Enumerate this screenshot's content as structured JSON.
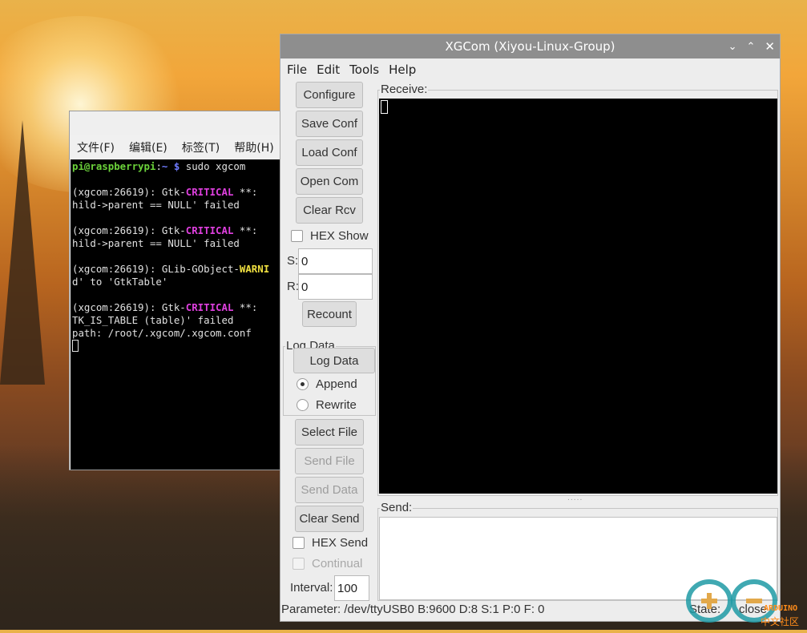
{
  "terminal": {
    "menu": [
      "文件(F)",
      "编辑(E)",
      "标签(T)",
      "帮助(H)"
    ],
    "lines": [
      {
        "parts": [
          {
            "t": "pi@raspberrypi",
            "c": "t-green"
          },
          {
            "t": ":",
            "c": ""
          },
          {
            "t": "~ $",
            "c": "t-blue"
          },
          {
            "t": " sudo xgcom",
            "c": ""
          }
        ]
      },
      {
        "parts": [
          {
            "t": "",
            "c": ""
          }
        ]
      },
      {
        "parts": [
          {
            "t": "(xgcom:26619): Gtk-",
            "c": ""
          },
          {
            "t": "CRITICAL",
            "c": "t-magenta"
          },
          {
            "t": " **: ",
            "c": ""
          }
        ]
      },
      {
        "parts": [
          {
            "t": "hild->parent == NULL' failed",
            "c": ""
          }
        ]
      },
      {
        "parts": [
          {
            "t": "",
            "c": ""
          }
        ]
      },
      {
        "parts": [
          {
            "t": "(xgcom:26619): Gtk-",
            "c": ""
          },
          {
            "t": "CRITICAL",
            "c": "t-magenta"
          },
          {
            "t": " **: ",
            "c": ""
          }
        ]
      },
      {
        "parts": [
          {
            "t": "hild->parent == NULL' failed",
            "c": ""
          }
        ]
      },
      {
        "parts": [
          {
            "t": "",
            "c": ""
          }
        ]
      },
      {
        "parts": [
          {
            "t": "(xgcom:26619): GLib-GObject-",
            "c": ""
          },
          {
            "t": "WARNI",
            "c": "t-yellow"
          }
        ]
      },
      {
        "parts": [
          {
            "t": "d' to 'GtkTable'",
            "c": ""
          }
        ]
      },
      {
        "parts": [
          {
            "t": "",
            "c": ""
          }
        ]
      },
      {
        "parts": [
          {
            "t": "(xgcom:26619): Gtk-",
            "c": ""
          },
          {
            "t": "CRITICAL",
            "c": "t-magenta"
          },
          {
            "t": " **: ",
            "c": ""
          }
        ]
      },
      {
        "parts": [
          {
            "t": "TK_IS_TABLE (table)' failed",
            "c": ""
          }
        ]
      },
      {
        "parts": [
          {
            "t": "path: /root/.xgcom/.xgcom.conf",
            "c": ""
          }
        ]
      }
    ]
  },
  "xgcom": {
    "title": "XGCom (Xiyou-Linux-Group)",
    "menu": {
      "file": "File",
      "edit": "Edit",
      "tools": "Tools",
      "help": "Help"
    },
    "buttons": {
      "configure": "Configure",
      "save_conf": "Save Conf",
      "load_conf": "Load Conf",
      "open_com": "Open Com",
      "clear_rcv": "Clear Rcv",
      "recount": "Recount",
      "log_data": "Log Data",
      "select_file": "Select File",
      "send_file": "Send File",
      "send_data": "Send Data",
      "clear_send": "Clear Send"
    },
    "hex_show": "HEX Show",
    "s_label": "S:",
    "s_value": "0",
    "r_label": "R:",
    "r_value": "0",
    "log_group": "Log Data",
    "append": "Append",
    "rewrite": "Rewrite",
    "hex_send": "HEX Send",
    "continual": "Continual",
    "interval_label": "Interval:",
    "interval_value": "100",
    "receive_label": "Receive:",
    "send_label": "Send:",
    "grip": ".....",
    "parameter": "Parameter: /dev/ttyUSB0 B:9600 D:8 S:1 P:0 F: 0",
    "state": "State:",
    "state_value": "close"
  },
  "watermark": {
    "brand": "ARDUINO",
    "sub": "中文社区"
  }
}
